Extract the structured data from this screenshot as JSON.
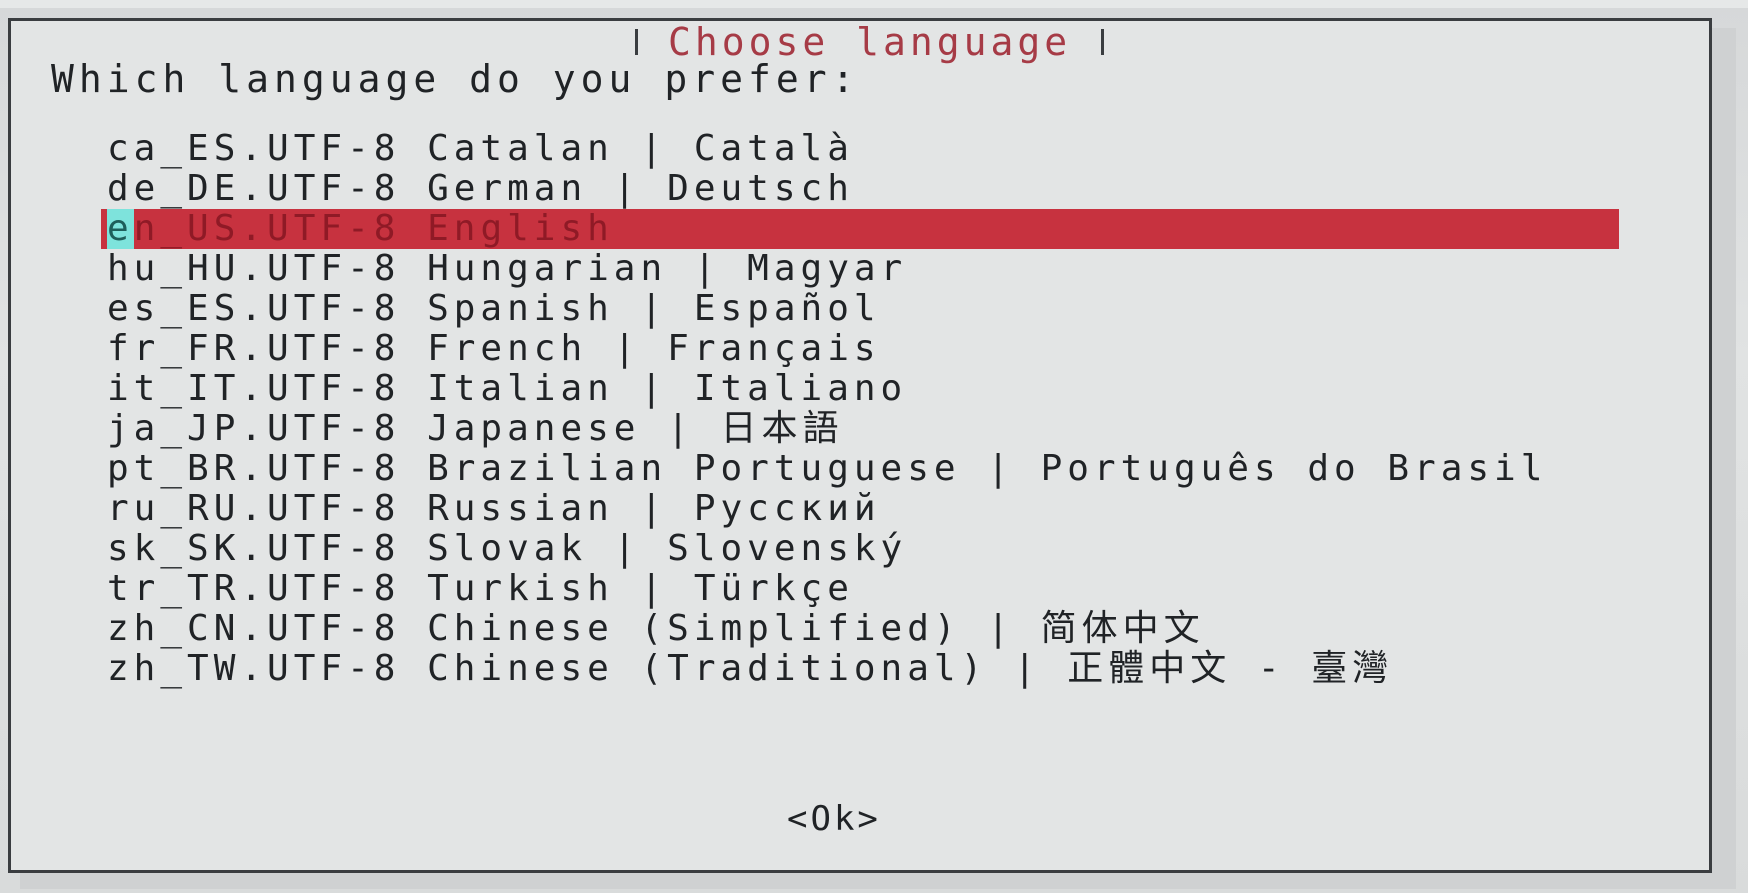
{
  "dialog": {
    "title": "Choose language",
    "prompt": "Which language do you prefer:",
    "ok_label": "<Ok>"
  },
  "languages": [
    {
      "label": "ca_ES.UTF-8 Catalan | Català",
      "selected": false
    },
    {
      "label": "de_DE.UTF-8 German | Deutsch",
      "selected": false
    },
    {
      "label": "en_US.UTF-8 English",
      "selected": true
    },
    {
      "label": "hu_HU.UTF-8 Hungarian | Magyar",
      "selected": false
    },
    {
      "label": "es_ES.UTF-8 Spanish | Español",
      "selected": false
    },
    {
      "label": "fr_FR.UTF-8 French | Français",
      "selected": false
    },
    {
      "label": "it_IT.UTF-8 Italian | Italiano",
      "selected": false
    },
    {
      "label": "ja_JP.UTF-8 Japanese | 日本語",
      "selected": false
    },
    {
      "label": "pt_BR.UTF-8 Brazilian Portuguese | Português do Brasil",
      "selected": false
    },
    {
      "label": "ru_RU.UTF-8 Russian | Русский",
      "selected": false
    },
    {
      "label": "sk_SK.UTF-8 Slovak | Slovenský",
      "selected": false
    },
    {
      "label": "tr_TR.UTF-8 Turkish | Türkçe",
      "selected": false
    },
    {
      "label": "zh_CN.UTF-8 Chinese (Simplified) | 简体中文",
      "selected": false
    },
    {
      "label": "zh_TW.UTF-8 Chinese (Traditional) | 正體中文 - 臺灣",
      "selected": false
    }
  ],
  "colors": {
    "selection_bg": "#c7323f",
    "title_fg": "#a63b46",
    "cursor_bg": "#7ee3dc",
    "dialog_bg": "#e3e5e5"
  }
}
